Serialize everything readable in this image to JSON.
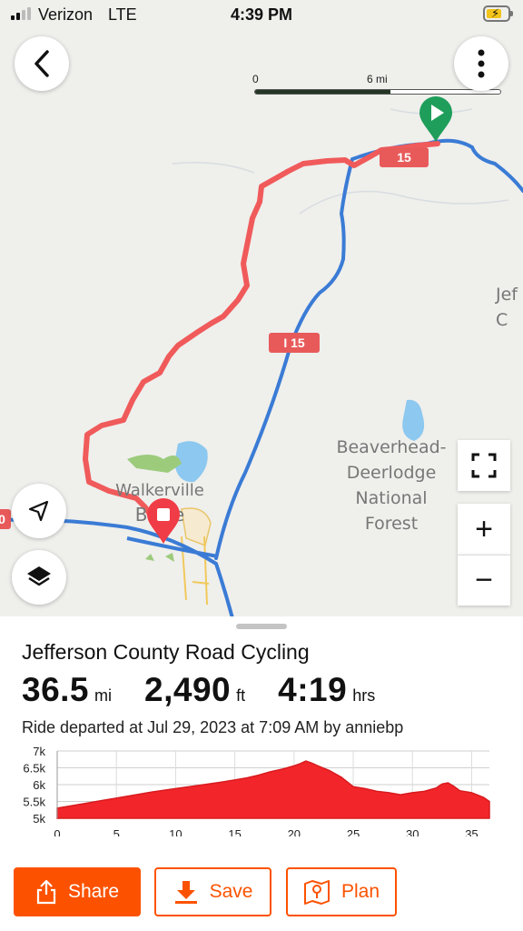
{
  "status_bar": {
    "carrier": "Verizon",
    "network": "LTE",
    "time": "4:39 PM",
    "battery_level": 0.6,
    "signal_bars": 2
  },
  "map": {
    "scale": {
      "start": "0",
      "mid": "6 mi",
      "end": "mi"
    },
    "labels": {
      "jefferson": "Jef\nC",
      "forest": "Beaverhead-\nDeerlodge\nNational\nForest",
      "walkerville": "Walkerville",
      "butte": "Butte"
    },
    "shields": {
      "i15_main": "I 15",
      "i15_top": "15",
      "left_edge": "0"
    },
    "controls": {
      "back_icon": "chevron-left-icon",
      "more_icon": "more-vertical-icon",
      "locate_icon": "navigation-arrow-icon",
      "layers_icon": "layers-icon",
      "fullscreen_icon": "fullscreen-icon",
      "zoom_in": "+",
      "zoom_out": "−"
    },
    "colors": {
      "route": "#f05a5a",
      "highway": "#3a7bd5",
      "start": "#1e9e5a",
      "end": "#f03c46"
    }
  },
  "route": {
    "title": "Jefferson County Road Cycling",
    "distance": {
      "value": "36.5",
      "unit": "mi"
    },
    "elevation": {
      "value": "2,490",
      "unit": "ft"
    },
    "time": {
      "value": "4:19",
      "unit": "hrs"
    },
    "ride_info": "Ride departed at Jul 29, 2023 at 7:09 AM by anniebp"
  },
  "chart_data": {
    "type": "area",
    "x_ticks": [
      0,
      5,
      10,
      15,
      20,
      25,
      30,
      35
    ],
    "y_ticks": [
      "5k",
      "5.5k",
      "6k",
      "6.5k",
      "7k"
    ],
    "y_tick_values": [
      5000,
      5500,
      6000,
      6500,
      7000
    ],
    "xlim": [
      0,
      36.5
    ],
    "ylim": [
      5000,
      7000
    ],
    "grid": true,
    "color": "#f2262a",
    "x": [
      0,
      2,
      4,
      6,
      8,
      10,
      12,
      14,
      16,
      17,
      18,
      19,
      20,
      20.5,
      21,
      21.5,
      22,
      23,
      24,
      25,
      26,
      27,
      28,
      29,
      30,
      31,
      32,
      32.5,
      33,
      33.5,
      34,
      35,
      36,
      36.5
    ],
    "y": [
      5300,
      5420,
      5540,
      5660,
      5780,
      5880,
      5980,
      6080,
      6200,
      6280,
      6380,
      6460,
      6560,
      6620,
      6700,
      6640,
      6560,
      6420,
      6220,
      5940,
      5880,
      5800,
      5760,
      5700,
      5760,
      5800,
      5900,
      6020,
      6050,
      5950,
      5820,
      5760,
      5620,
      5500
    ]
  },
  "actions": {
    "share": "Share",
    "save": "Save",
    "plan": "Plan"
  }
}
